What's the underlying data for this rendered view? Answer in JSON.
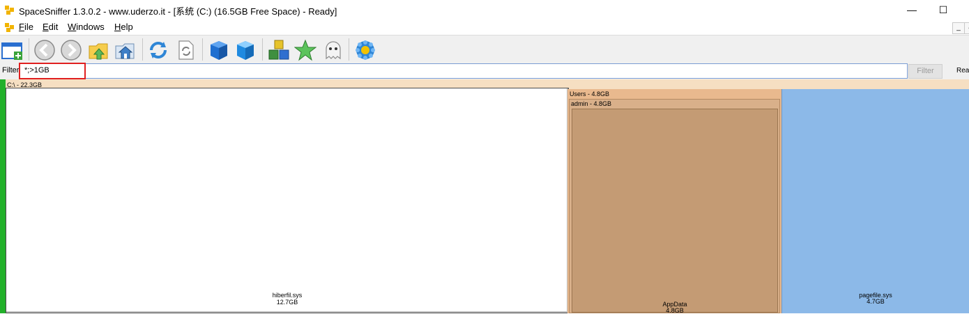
{
  "window": {
    "title": "SpaceSniffer 1.3.0.2 - www.uderzo.it - [系统 (C:) (16.5GB Free Space) - Ready]",
    "minimize": "—",
    "maximize": "☐"
  },
  "menu": {
    "items": [
      {
        "label": "File"
      },
      {
        "label": "Edit"
      },
      {
        "label": "Windows"
      },
      {
        "label": "Help"
      }
    ],
    "mdi_min": "_",
    "mdi_restore": "a"
  },
  "toolbar": {
    "buttons": [
      {
        "name": "new-window"
      },
      {
        "name": "back"
      },
      {
        "name": "forward"
      },
      {
        "name": "parent-folder"
      },
      {
        "name": "home"
      },
      {
        "name": "refresh"
      },
      {
        "name": "refresh-document"
      },
      {
        "name": "zoom-in-cube"
      },
      {
        "name": "zoom-out-cube"
      },
      {
        "name": "blocks"
      },
      {
        "name": "favorite"
      },
      {
        "name": "ghost"
      },
      {
        "name": "settings"
      }
    ]
  },
  "filter": {
    "label": "Filter",
    "value": "*;>1GB",
    "button": "Filter",
    "status": "Rea"
  },
  "treemap": {
    "root_label": "C:\\ - 22.3GB",
    "items": {
      "hiberfil": {
        "name": "hiberfil.sys",
        "size": "12.7GB",
        "color": "#ffffff"
      },
      "users": {
        "label": "Users - 4.8GB",
        "color": "#e9b98e"
      },
      "admin": {
        "label": "admin - 4.8GB",
        "color": "#d9b08a"
      },
      "appdata": {
        "name": "AppData",
        "size": "4.8GB",
        "color": "#c49b74"
      },
      "pagefile": {
        "name": "pagefile.sys",
        "size": "4.7GB",
        "color": "#8cb9e8"
      }
    },
    "accent_green": "#22b02a"
  }
}
